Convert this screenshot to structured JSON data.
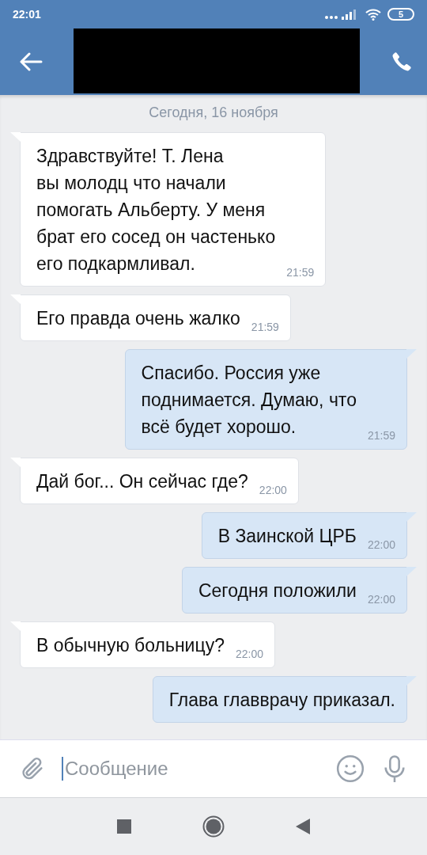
{
  "status_bar": {
    "time": "22:01",
    "battery": "5"
  },
  "header": {
    "redacted": true
  },
  "date_divider": "Сегодня, 16 ноября",
  "messages": [
    {
      "kind": "incoming",
      "text": "Здравствуйте! Т. Лена\nвы молодц что начали\nпомогать Альберту. У меня\nбрат его сосед он частенько\nего подкармливал.",
      "time": "21:59"
    },
    {
      "kind": "incoming",
      "text": "Его правда очень жалко",
      "time": "21:59"
    },
    {
      "kind": "outgoing",
      "text": "Спасибо. Россия уже\nподнимается. Думаю, что\nвсё будет хорошо.",
      "time": "21:59"
    },
    {
      "kind": "incoming",
      "text": "Дай бог... Он сейчас где?",
      "time": "22:00"
    },
    {
      "kind": "outgoing",
      "text": "В Заинской ЦРБ",
      "time": "22:00"
    },
    {
      "kind": "outgoing",
      "text": "Сегодня положили",
      "time": "22:00"
    },
    {
      "kind": "incoming",
      "text": "В обычную больницу?",
      "time": "22:00"
    },
    {
      "kind": "outgoing",
      "text": "Глава главврачу приказал."
    }
  ],
  "composer": {
    "placeholder": "Сообщение"
  }
}
